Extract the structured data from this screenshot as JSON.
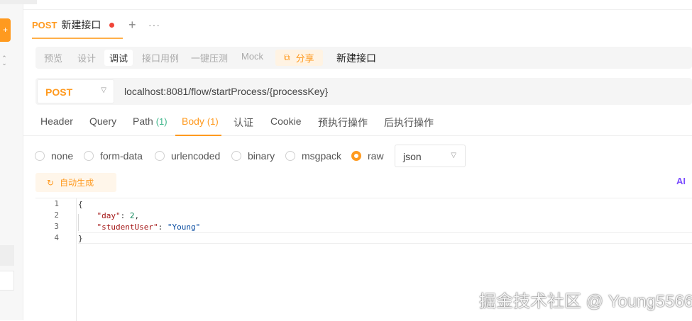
{
  "left_rail": {
    "add_icon": "plus-icon",
    "expand_icon": "expand-arrows-icon"
  },
  "tab": {
    "method": "POST",
    "name": "新建接口",
    "add_label": "+",
    "more_label": "···"
  },
  "modes": [
    "预览",
    "设计",
    "调试",
    "接口用例",
    "一键压测",
    "Mock"
  ],
  "active_mode": "调试",
  "share": {
    "label": "分享",
    "icon": "share-icon"
  },
  "doc_title": "新建接口",
  "request": {
    "method": "POST",
    "url": "localhost:8081/flow/startProcess/{processKey}"
  },
  "param_tabs": [
    {
      "label": "Header",
      "count": ""
    },
    {
      "label": "Query",
      "count": ""
    },
    {
      "label": "Path",
      "count": "(1)"
    },
    {
      "label": "Body",
      "count": "(1)"
    },
    {
      "label": "认证",
      "count": ""
    },
    {
      "label": "Cookie",
      "count": ""
    },
    {
      "label": "预执行操作",
      "count": ""
    },
    {
      "label": "后执行操作",
      "count": ""
    }
  ],
  "active_param_tab": "Body",
  "body_types": [
    "none",
    "form-data",
    "urlencoded",
    "binary",
    "msgpack",
    "raw"
  ],
  "selected_body_type": "raw",
  "raw_format": "json",
  "auto_generate": {
    "label": "自动生成",
    "icon": "refresh-icon"
  },
  "ai_label": "AI",
  "editor": {
    "line_numbers": [
      "1",
      "2",
      "3",
      "4"
    ],
    "lines": [
      "{",
      "    \"day\": 2,",
      "    \"studentUser\": \"Young\"",
      "}"
    ],
    "key_day": "\"day\"",
    "val_day": "2",
    "key_student": "\"studentUser\"",
    "val_student": "\"Young\""
  },
  "watermark": "掘金技术社区 @ Young5566",
  "colors": {
    "accent": "#ff9a1f",
    "count_green": "#3fb68b",
    "ai_purple": "#7b4dff",
    "dirty_dot": "#f04438"
  }
}
